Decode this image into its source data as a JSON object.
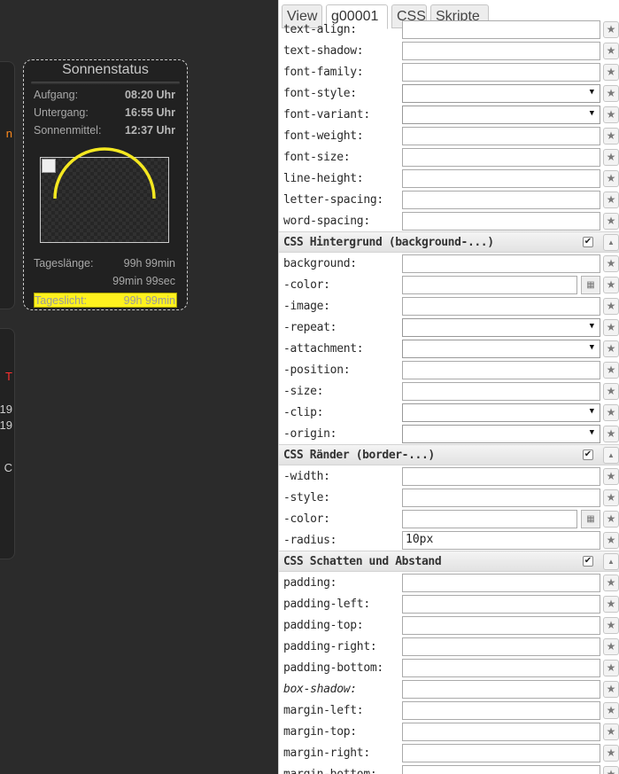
{
  "widget": {
    "title": "Sonnenstatus",
    "rows": [
      {
        "label": "Aufgang:",
        "value": "08:20 Uhr"
      },
      {
        "label": "Untergang:",
        "value": "16:55 Uhr"
      },
      {
        "label": "Sonnenmittel:",
        "value": "12:37 Uhr"
      }
    ],
    "day_length_label": "Tageslänge:",
    "day_length_value": "99h 99min",
    "day_length_sub": "99min 99sec",
    "daylight_label": "Tageslicht:",
    "daylight_value": "99h 99min",
    "arc_color": "#f5e820"
  },
  "cut_widgets": {
    "w1_text": "n",
    "w2_text1": "T",
    "w2_text2": "19",
    "w2_text3": "19",
    "w2_text4": "C"
  },
  "tabs": [
    {
      "label": "View",
      "active": false
    },
    {
      "label": "g00001",
      "active": true
    },
    {
      "label": "CSS",
      "active": false
    },
    {
      "label": "Skripte",
      "active": false
    }
  ],
  "panel": {
    "items": [
      {
        "kind": "field",
        "label": "text-align:",
        "value": ""
      },
      {
        "kind": "field",
        "label": "text-shadow:",
        "value": ""
      },
      {
        "kind": "field",
        "label": "font-family:",
        "value": ""
      },
      {
        "kind": "select",
        "label": "font-style:",
        "value": ""
      },
      {
        "kind": "select",
        "label": "font-variant:",
        "value": ""
      },
      {
        "kind": "field",
        "label": "font-weight:",
        "value": ""
      },
      {
        "kind": "field",
        "label": "font-size:",
        "value": ""
      },
      {
        "kind": "field",
        "label": "line-height:",
        "value": ""
      },
      {
        "kind": "field",
        "label": "letter-spacing:",
        "value": ""
      },
      {
        "kind": "field",
        "label": "word-spacing:",
        "value": ""
      },
      {
        "kind": "section",
        "label": "CSS Hintergrund (background-...)",
        "checked": true
      },
      {
        "kind": "field",
        "label": "background:",
        "value": ""
      },
      {
        "kind": "color",
        "label": "-color:",
        "value": ""
      },
      {
        "kind": "field",
        "label": "-image:",
        "value": ""
      },
      {
        "kind": "select",
        "label": "-repeat:",
        "value": ""
      },
      {
        "kind": "select",
        "label": "-attachment:",
        "value": ""
      },
      {
        "kind": "field",
        "label": "-position:",
        "value": ""
      },
      {
        "kind": "field",
        "label": "-size:",
        "value": ""
      },
      {
        "kind": "select",
        "label": "-clip:",
        "value": ""
      },
      {
        "kind": "select",
        "label": "-origin:",
        "value": ""
      },
      {
        "kind": "section",
        "label": "CSS Ränder (border-...)",
        "checked": true
      },
      {
        "kind": "field",
        "label": "-width:",
        "value": ""
      },
      {
        "kind": "field",
        "label": "-style:",
        "value": ""
      },
      {
        "kind": "color",
        "label": "-color:",
        "value": ""
      },
      {
        "kind": "field",
        "label": "-radius:",
        "value": "10px"
      },
      {
        "kind": "section",
        "label": "CSS Schatten und Abstand",
        "checked": true
      },
      {
        "kind": "field",
        "label": "padding:",
        "value": ""
      },
      {
        "kind": "field",
        "label": "padding-left:",
        "value": ""
      },
      {
        "kind": "field",
        "label": "padding-top:",
        "value": ""
      },
      {
        "kind": "field",
        "label": "padding-right:",
        "value": ""
      },
      {
        "kind": "field",
        "label": "padding-bottom:",
        "value": ""
      },
      {
        "kind": "field",
        "label": "box-shadow:",
        "value": "",
        "italic": true
      },
      {
        "kind": "field",
        "label": "margin-left:",
        "value": ""
      },
      {
        "kind": "field",
        "label": "margin-top:",
        "value": ""
      },
      {
        "kind": "field",
        "label": "margin-right:",
        "value": ""
      },
      {
        "kind": "field",
        "label": "margin-bottom:",
        "value": ""
      }
    ]
  },
  "icons": {
    "star": "★",
    "caret": "▼",
    "collapse": "▲",
    "check": "✔",
    "swatch": "▦"
  }
}
